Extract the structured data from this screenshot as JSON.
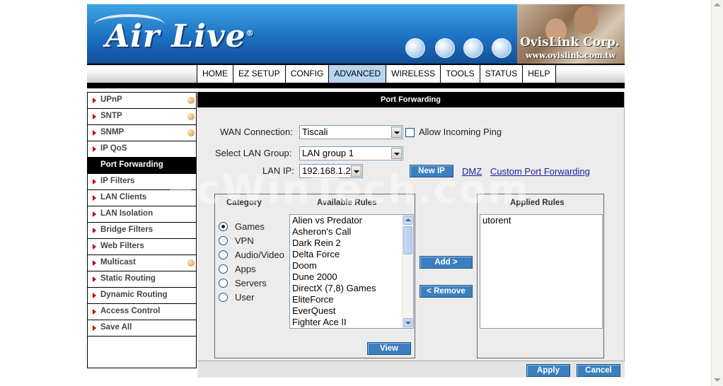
{
  "brand": {
    "logo_text": "Air Live",
    "logo_mark": "®",
    "corp_name": "OvisLink Corp.",
    "corp_url": "www.ovislink.com.tw"
  },
  "nav": {
    "tabs": [
      {
        "label": "HOME",
        "active": false
      },
      {
        "label": "EZ SETUP",
        "active": false
      },
      {
        "label": "CONFIG",
        "active": false
      },
      {
        "label": "ADVANCED",
        "active": true
      },
      {
        "label": "WIRELESS",
        "active": false
      },
      {
        "label": "TOOLS",
        "active": false
      },
      {
        "label": "STATUS",
        "active": false
      },
      {
        "label": "HELP",
        "active": false
      }
    ]
  },
  "sidebar": {
    "items": [
      {
        "label": "UPnP",
        "dot": true
      },
      {
        "label": "SNTP",
        "dot": true
      },
      {
        "label": "SNMP",
        "dot": true
      },
      {
        "label": "IP QoS",
        "dot": false
      },
      {
        "label": "Port Forwarding",
        "dot": false,
        "active": true
      },
      {
        "label": "IP Filters",
        "dot": false
      },
      {
        "label": "LAN Clients",
        "dot": false
      },
      {
        "label": "LAN Isolation",
        "dot": false
      },
      {
        "label": "Bridge Filters",
        "dot": false
      },
      {
        "label": "Web Filters",
        "dot": false
      },
      {
        "label": "Multicast",
        "dot": true
      },
      {
        "label": "Static Routing",
        "dot": false
      },
      {
        "label": "Dynamic Routing",
        "dot": false
      },
      {
        "label": "Access Control",
        "dot": false
      },
      {
        "label": "Save All",
        "dot": false
      }
    ]
  },
  "page": {
    "title": "Port Forwarding",
    "wan_label": "WAN Connection:",
    "wan_value": "Tiscali",
    "allow_ping_label": "Allow Incoming Ping",
    "allow_ping_checked": false,
    "lan_group_label": "Select LAN Group:",
    "lan_group_value": "LAN group 1",
    "lan_ip_label": "LAN IP:",
    "lan_ip_value": "192.168.1.2",
    "new_ip_button": "New IP",
    "dmz_link": "DMZ",
    "custom_link": "Custom Port Forwarding"
  },
  "category": {
    "header": "Category",
    "options": [
      {
        "label": "Games",
        "selected": true
      },
      {
        "label": "VPN",
        "selected": false
      },
      {
        "label": "Audio/Video",
        "selected": false
      },
      {
        "label": "Apps",
        "selected": false
      },
      {
        "label": "Servers",
        "selected": false
      },
      {
        "label": "User",
        "selected": false
      }
    ]
  },
  "available": {
    "header": "Available Rules",
    "items": [
      "Alien vs Predator",
      "Asheron's Call",
      "Dark Rein 2",
      "Delta Force",
      "Doom",
      "Dune 2000",
      "DirectX (7,8) Games",
      "EliteForce",
      "EverQuest",
      "Fighter Ace II"
    ],
    "view_button": "View"
  },
  "actions": {
    "add_button": "Add >",
    "remove_button": "< Remove"
  },
  "applied": {
    "header": "Applied Rules",
    "items": [
      "utorent"
    ]
  },
  "footer": {
    "apply_button": "Apply",
    "cancel_button": "Cancel"
  },
  "watermark": "PcWinTech.com"
}
